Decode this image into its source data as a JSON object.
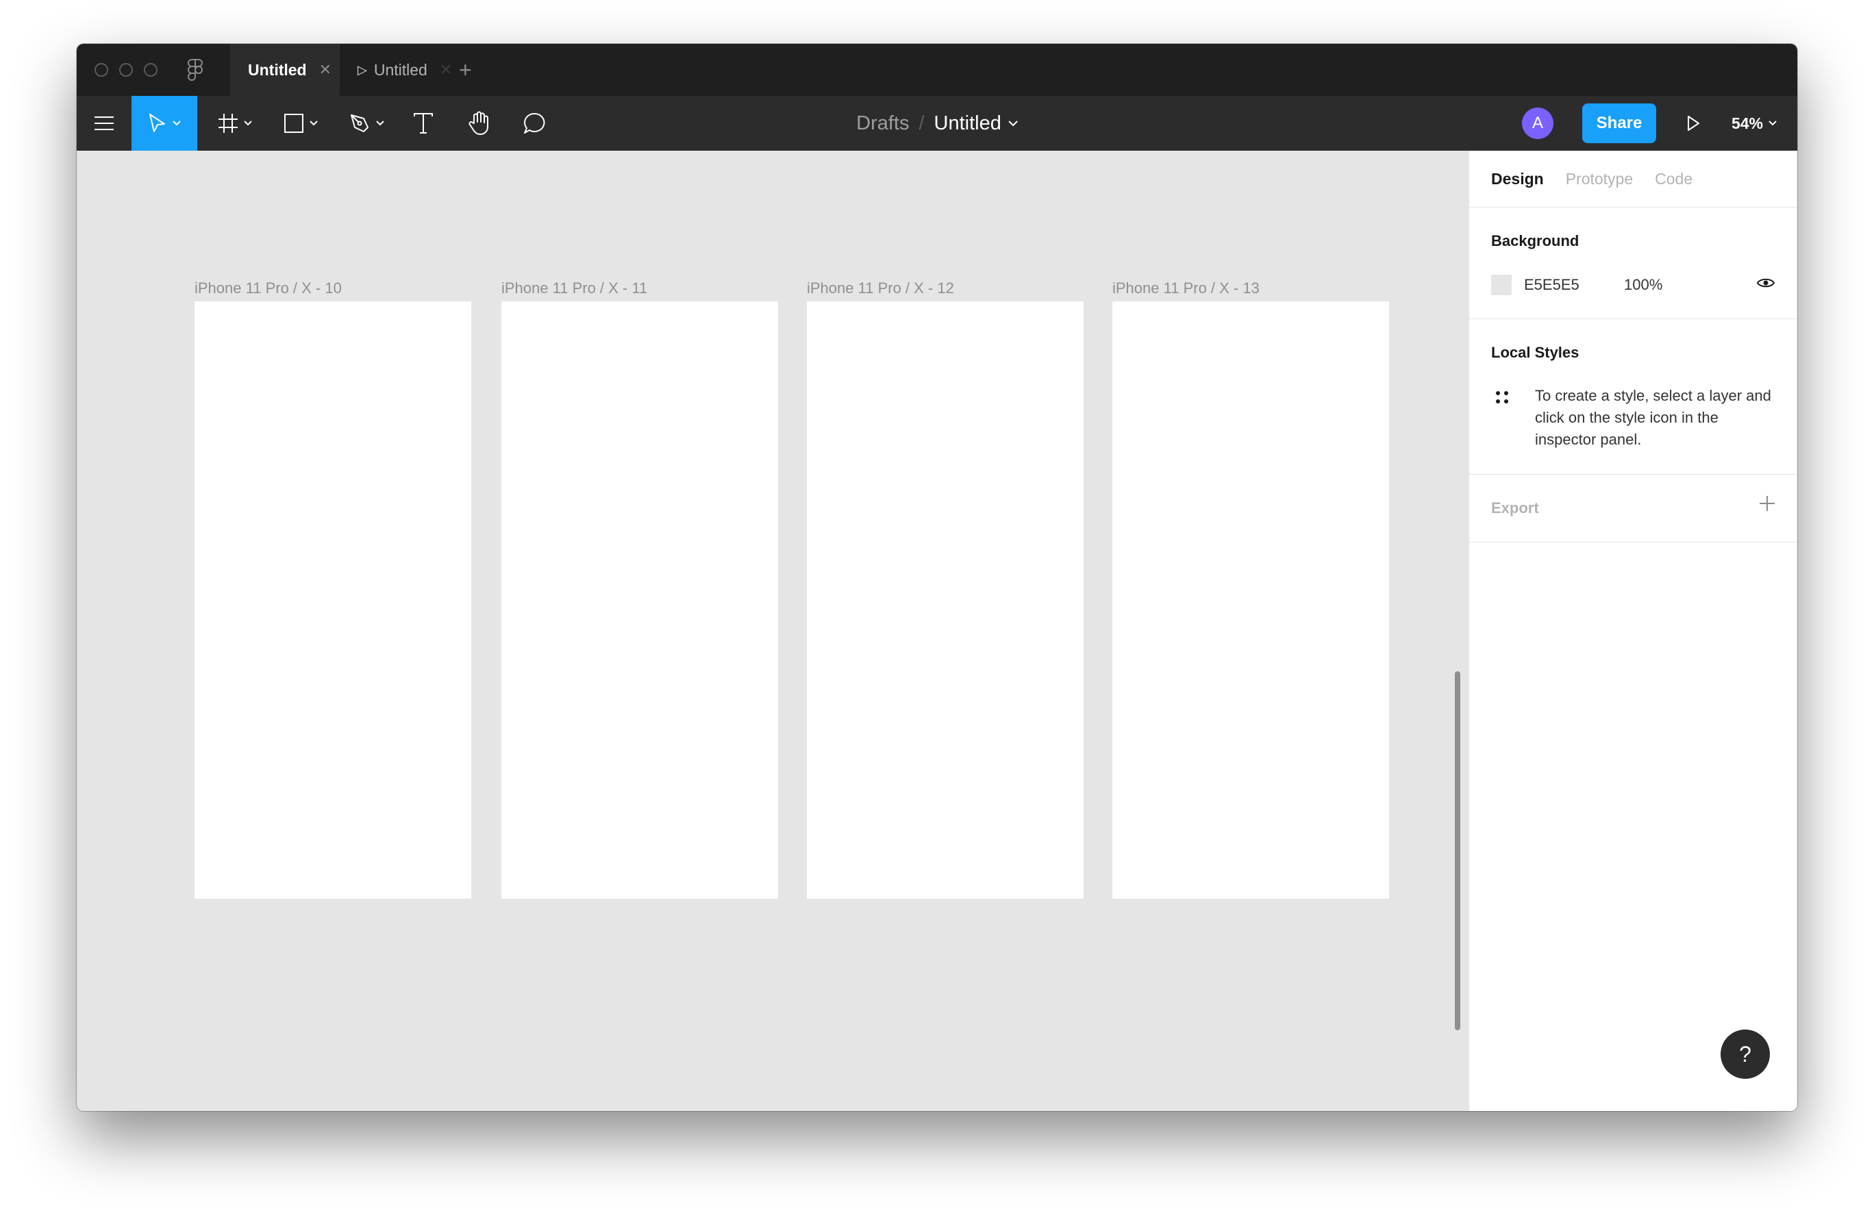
{
  "tabs": [
    {
      "label": "Untitled",
      "close_icon": "close-icon",
      "active": true
    },
    {
      "label": "Untitled",
      "close_icon": "close-icon",
      "active": false,
      "icon": "play-icon"
    }
  ],
  "toolbar": {
    "breadcrumb": {
      "parent": "Drafts",
      "separator": "/",
      "file": "Untitled"
    },
    "avatar_initial": "A",
    "share_label": "Share",
    "zoom": "54%"
  },
  "canvas": {
    "frames": [
      {
        "label": "iPhone 11 Pro / X - 10"
      },
      {
        "label": "iPhone 11 Pro / X - 11"
      },
      {
        "label": "iPhone 11 Pro / X - 12"
      },
      {
        "label": "iPhone 11 Pro / X - 13"
      }
    ]
  },
  "panel": {
    "tabs": [
      "Design",
      "Prototype",
      "Code"
    ],
    "background": {
      "title": "Background",
      "hex": "E5E5E5",
      "opacity": "100%"
    },
    "local_styles": {
      "title": "Local Styles",
      "hint": "To create a style, select a layer and click on the style icon in the inspector panel."
    },
    "export": {
      "title": "Export"
    }
  },
  "help_label": "?",
  "colors": {
    "accent": "#18a0fb",
    "avatar": "#7b61ff",
    "titlebar": "#1f1f1f",
    "toolbar": "#2c2c2c",
    "canvas": "#e5e5e5"
  }
}
